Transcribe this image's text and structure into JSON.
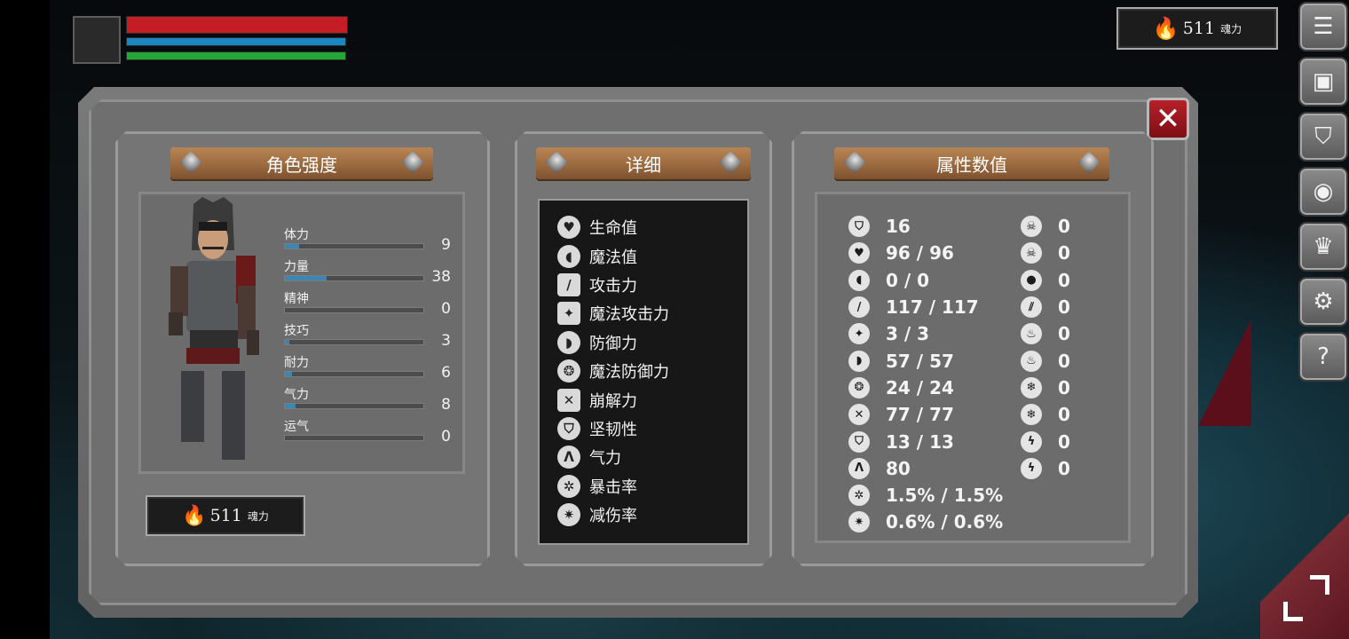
{
  "hud": {
    "soul_value": "511",
    "soul_label": "魂力",
    "colors": {
      "hp": "#c41d25",
      "mp": "#1b86bf",
      "stamina": "#23a836"
    }
  },
  "right_menu": {
    "icons": [
      "list-icon",
      "character-sheet-icon",
      "helmet-icon",
      "rune-icon",
      "crown-icon",
      "gear-icon",
      "help-icon"
    ]
  },
  "panel": {
    "close_icon": "close-icon",
    "left": {
      "title": "角色强度",
      "stats": [
        {
          "label": "体力",
          "value": "9",
          "fill": 0.1
        },
        {
          "label": "力量",
          "value": "38",
          "fill": 0.3
        },
        {
          "label": "精神",
          "value": "0",
          "fill": 0.0
        },
        {
          "label": "技巧",
          "value": "3",
          "fill": 0.03
        },
        {
          "label": "耐力",
          "value": "6",
          "fill": 0.05
        },
        {
          "label": "气力",
          "value": "8",
          "fill": 0.08
        },
        {
          "label": "运气",
          "value": "0",
          "fill": 0.0
        }
      ],
      "soul_value": "511",
      "soul_label": "魂力"
    },
    "middle": {
      "title": "详细",
      "rows": [
        {
          "icon": "heart-icon",
          "glyph": "♥",
          "label": "生命值"
        },
        {
          "icon": "head-icon",
          "glyph": "◖",
          "label": "魔法值"
        },
        {
          "icon": "sword-icon",
          "glyph": "/",
          "label": "攻击力"
        },
        {
          "icon": "magic-tome-icon",
          "glyph": "✦",
          "label": "魔法攻击力"
        },
        {
          "icon": "shield-icon",
          "glyph": "◗",
          "label": "防御力"
        },
        {
          "icon": "magic-shield-icon",
          "glyph": "❂",
          "label": "魔法防御力"
        },
        {
          "icon": "break-icon",
          "glyph": "✕",
          "label": "崩解力"
        },
        {
          "icon": "helmet-icon",
          "glyph": "⛉",
          "label": "坚韧性"
        },
        {
          "icon": "lungs-icon",
          "glyph": "ᐱ",
          "label": "气力"
        },
        {
          "icon": "critical-icon",
          "glyph": "✲",
          "label": "暴击率"
        },
        {
          "icon": "damage-reduction-icon",
          "glyph": "✷",
          "label": "减伤率"
        }
      ]
    },
    "right": {
      "title": "属性数值",
      "col1": [
        {
          "icon": "helmet-icon",
          "glyph": "⛉",
          "value": "16"
        },
        {
          "icon": "heart-icon",
          "glyph": "♥",
          "value": "96 / 96"
        },
        {
          "icon": "head-icon",
          "glyph": "◖",
          "value": "0 / 0"
        },
        {
          "icon": "sword-icon",
          "glyph": "/",
          "value": "117 / 117"
        },
        {
          "icon": "magic-tome-icon",
          "glyph": "✦",
          "value": "3 / 3"
        },
        {
          "icon": "shield-icon",
          "glyph": "◗",
          "value": "57 / 57"
        },
        {
          "icon": "magic-shield-icon",
          "glyph": "❂",
          "value": "24 / 24"
        },
        {
          "icon": "break-icon",
          "glyph": "✕",
          "value": "77 / 77"
        },
        {
          "icon": "toughness-icon",
          "glyph": "⛉",
          "value": "13 / 13"
        },
        {
          "icon": "lungs-icon",
          "glyph": "ᐱ",
          "value": "80"
        },
        {
          "icon": "critical-icon",
          "glyph": "✲",
          "value": "1.5% / 1.5%"
        },
        {
          "icon": "damage-reduction-icon",
          "glyph": "✷",
          "value": "0.6% / 0.6%"
        }
      ],
      "col2": [
        {
          "icon": "poison-skull-icon",
          "glyph": "☠",
          "value": "0"
        },
        {
          "icon": "bleed-skull-icon",
          "glyph": "☠",
          "value": "0"
        },
        {
          "icon": "blood-drop-icon",
          "glyph": "●",
          "value": "0"
        },
        {
          "icon": "slash-resist-icon",
          "glyph": "⫽",
          "value": "0"
        },
        {
          "icon": "fire-icon",
          "glyph": "♨",
          "value": "0"
        },
        {
          "icon": "burn-icon",
          "glyph": "♨",
          "value": "0"
        },
        {
          "icon": "frost-icon",
          "glyph": "❄",
          "value": "0"
        },
        {
          "icon": "freeze-icon",
          "glyph": "❄",
          "value": "0"
        },
        {
          "icon": "lightning-icon",
          "glyph": "ϟ",
          "value": "0"
        },
        {
          "icon": "shock-icon",
          "glyph": "ϟ",
          "value": "0"
        }
      ]
    }
  }
}
